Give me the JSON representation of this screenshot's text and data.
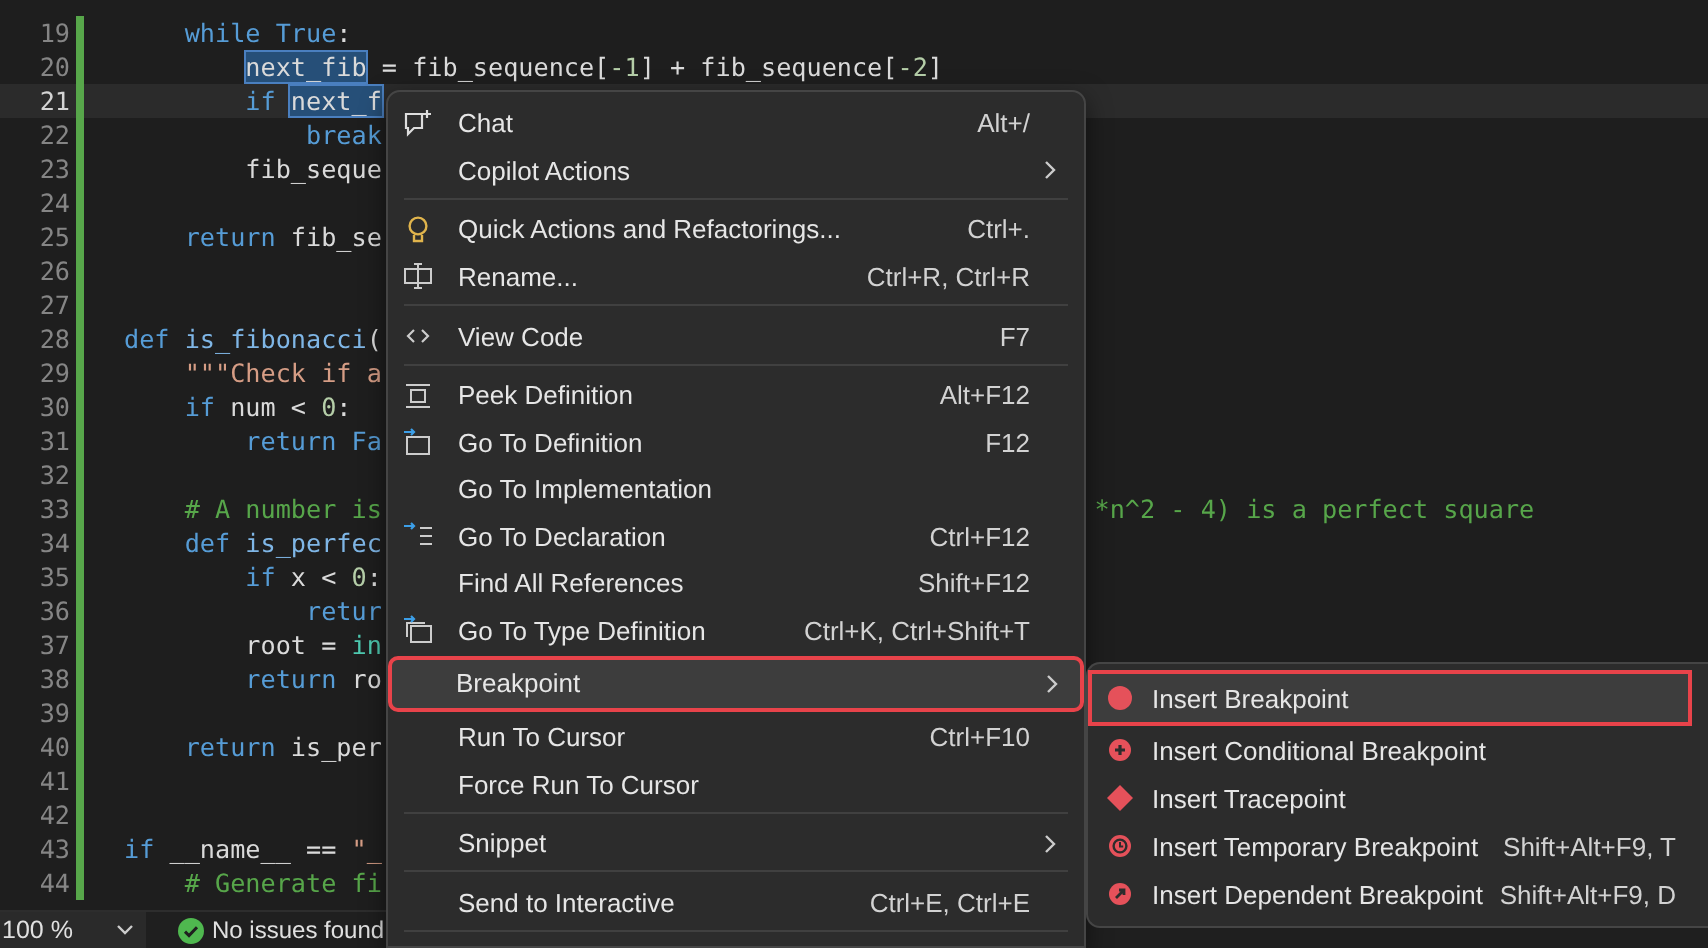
{
  "editor": {
    "lines": [
      {
        "number": "19",
        "current": false,
        "tokens": [
          {
            "kind": "keyword",
            "text": "    while"
          },
          {
            "kind": "keyword",
            "text": " True"
          },
          {
            "kind": "plain",
            "text": ":"
          }
        ]
      },
      {
        "number": "20",
        "current": false,
        "tokens": [
          {
            "kind": "plain",
            "text": "        next_fib",
            "highlight": true
          },
          {
            "kind": "plain",
            "text": " = fib_sequence["
          },
          {
            "kind": "number",
            "text": "-1"
          },
          {
            "kind": "plain",
            "text": "] + fib_sequence["
          },
          {
            "kind": "number",
            "text": "-2"
          },
          {
            "kind": "plain",
            "text": "]"
          }
        ]
      },
      {
        "number": "21",
        "current": true,
        "tokens": [
          {
            "kind": "keyword",
            "text": "        if"
          },
          {
            "kind": "plain",
            "text": " next_f",
            "highlight": true
          }
        ]
      },
      {
        "number": "22",
        "current": false,
        "tokens": [
          {
            "kind": "keyword",
            "text": "            break"
          }
        ]
      },
      {
        "number": "23",
        "current": false,
        "tokens": [
          {
            "kind": "plain",
            "text": "        fib_seque"
          }
        ]
      },
      {
        "number": "24",
        "current": false
      },
      {
        "number": "25",
        "current": false,
        "tokens": [
          {
            "kind": "keyword",
            "text": "    return"
          },
          {
            "kind": "plain",
            "text": " fib_se"
          }
        ]
      },
      {
        "number": "26",
        "current": false
      },
      {
        "number": "27",
        "current": false
      },
      {
        "number": "28",
        "current": false,
        "tokens": [
          {
            "kind": "keyword",
            "text": "def"
          },
          {
            "kind": "function",
            "text": " is_fibonacci"
          },
          {
            "kind": "plain",
            "text": "("
          }
        ]
      },
      {
        "number": "29",
        "current": false,
        "tokens": [
          {
            "kind": "string",
            "text": "    \"\"\"Check if a"
          }
        ]
      },
      {
        "number": "30",
        "current": false,
        "tokens": [
          {
            "kind": "keyword",
            "text": "    if"
          },
          {
            "kind": "plain",
            "text": " num < "
          },
          {
            "kind": "number",
            "text": "0"
          },
          {
            "kind": "plain",
            "text": ":"
          }
        ]
      },
      {
        "number": "31",
        "current": false,
        "tokens": [
          {
            "kind": "keyword",
            "text": "        return"
          },
          {
            "kind": "keyword",
            "text": " Fa"
          }
        ]
      },
      {
        "number": "32",
        "current": false
      },
      {
        "number": "33",
        "current": false,
        "tokens": [
          {
            "kind": "comment",
            "text": "    # A number is"
          }
        ],
        "tail": [
          {
            "kind": "comment",
            "text": "*n^2 - 4) is a perfect square"
          }
        ]
      },
      {
        "number": "34",
        "current": false,
        "tokens": [
          {
            "kind": "keyword",
            "text": "    def"
          },
          {
            "kind": "function",
            "text": " is_perfec"
          }
        ]
      },
      {
        "number": "35",
        "current": false,
        "tokens": [
          {
            "kind": "keyword",
            "text": "        if"
          },
          {
            "kind": "plain",
            "text": " x < "
          },
          {
            "kind": "number",
            "text": "0"
          },
          {
            "kind": "plain",
            "text": ":"
          }
        ]
      },
      {
        "number": "36",
        "current": false,
        "tokens": [
          {
            "kind": "keyword",
            "text": "            retur"
          }
        ]
      },
      {
        "number": "37",
        "current": false,
        "tokens": [
          {
            "kind": "plain",
            "text": "        root = "
          },
          {
            "kind": "builtin",
            "text": "in"
          }
        ]
      },
      {
        "number": "38",
        "current": false,
        "tokens": [
          {
            "kind": "keyword",
            "text": "        return"
          },
          {
            "kind": "plain",
            "text": " ro"
          }
        ]
      },
      {
        "number": "39",
        "current": false
      },
      {
        "number": "40",
        "current": false,
        "tokens": [
          {
            "kind": "keyword",
            "text": "    return"
          },
          {
            "kind": "plain",
            "text": " is_per"
          }
        ]
      },
      {
        "number": "41",
        "current": false
      },
      {
        "number": "42",
        "current": false
      },
      {
        "number": "43",
        "current": false,
        "tokens": [
          {
            "kind": "keyword",
            "text": "if"
          },
          {
            "kind": "plain",
            "text": " __name__ == "
          },
          {
            "kind": "string",
            "text": "\"_"
          }
        ]
      },
      {
        "number": "44",
        "current": false,
        "tokens": [
          {
            "kind": "comment",
            "text": "    # Generate fi"
          }
        ]
      }
    ]
  },
  "context_menu": {
    "items": [
      {
        "kind": "chat",
        "label": "Chat",
        "shortcut": "Alt+/",
        "submenu": false,
        "selected": false,
        "annotated": false
      },
      {
        "kind": "plain",
        "label": "Copilot Actions",
        "submenu": true,
        "selected": false,
        "annotated": false
      },
      {
        "kind": "separator"
      },
      {
        "kind": "lightbulb",
        "label": "Quick Actions and Refactorings...",
        "shortcut": "Ctrl+.",
        "submenu": false,
        "selected": false,
        "annotated": false
      },
      {
        "kind": "rename",
        "label": "Rename...",
        "shortcut": "Ctrl+R, Ctrl+R",
        "submenu": false,
        "selected": false,
        "annotated": false
      },
      {
        "kind": "separator"
      },
      {
        "kind": "code",
        "label": "View Code",
        "shortcut": "F7",
        "submenu": false,
        "selected": false,
        "annotated": false
      },
      {
        "kind": "separator"
      },
      {
        "kind": "peek",
        "label": "Peek Definition",
        "shortcut": "Alt+F12",
        "submenu": false,
        "selected": false,
        "annotated": false
      },
      {
        "kind": "definition",
        "label": "Go To Definition",
        "shortcut": "F12",
        "submenu": false,
        "selected": false,
        "annotated": false
      },
      {
        "kind": "plain",
        "label": "Go To Implementation",
        "submenu": false,
        "selected": false,
        "annotated": false
      },
      {
        "kind": "declaration",
        "label": "Go To Declaration",
        "shortcut": "Ctrl+F12",
        "submenu": false,
        "selected": false,
        "annotated": false
      },
      {
        "kind": "plain",
        "label": "Find All References",
        "shortcut": "Shift+F12",
        "submenu": false,
        "selected": false,
        "annotated": false
      },
      {
        "kind": "typedef",
        "label": "Go To Type Definition",
        "shortcut": "Ctrl+K, Ctrl+Shift+T",
        "submenu": false,
        "selected": false,
        "annotated": false
      },
      {
        "kind": "plain",
        "label": "Breakpoint",
        "submenu": true,
        "selected": true,
        "annotated": true
      },
      {
        "kind": "plain",
        "label": "Run To Cursor",
        "shortcut": "Ctrl+F10",
        "submenu": false,
        "selected": false,
        "annotated": false
      },
      {
        "kind": "plain",
        "label": "Force Run To Cursor",
        "submenu": false,
        "selected": false,
        "annotated": false
      },
      {
        "kind": "separator"
      },
      {
        "kind": "plain",
        "label": "Snippet",
        "submenu": true,
        "selected": false,
        "annotated": false
      },
      {
        "kind": "separator"
      },
      {
        "kind": "plain",
        "label": "Send to Interactive",
        "shortcut": "Ctrl+E, Ctrl+E",
        "submenu": false,
        "selected": false,
        "annotated": false
      },
      {
        "kind": "separator"
      }
    ]
  },
  "submenu": {
    "items": [
      {
        "kind": "breakpoint",
        "label": "Insert Breakpoint",
        "selected": true,
        "annotated": true
      },
      {
        "kind": "conditional",
        "label": "Insert Conditional Breakpoint",
        "selected": false,
        "annotated": false
      },
      {
        "kind": "tracepoint",
        "label": "Insert Tracepoint",
        "selected": false,
        "annotated": false
      },
      {
        "kind": "temporary",
        "label": "Insert Temporary Breakpoint",
        "shortcut": "Shift+Alt+F9, T",
        "selected": false,
        "annotated": false
      },
      {
        "kind": "dependent",
        "label": "Insert Dependent Breakpoint",
        "shortcut": "Shift+Alt+F9, D",
        "selected": false,
        "annotated": false
      }
    ]
  },
  "status_bar": {
    "zoom": "100 %",
    "issues": "No issues found"
  }
}
